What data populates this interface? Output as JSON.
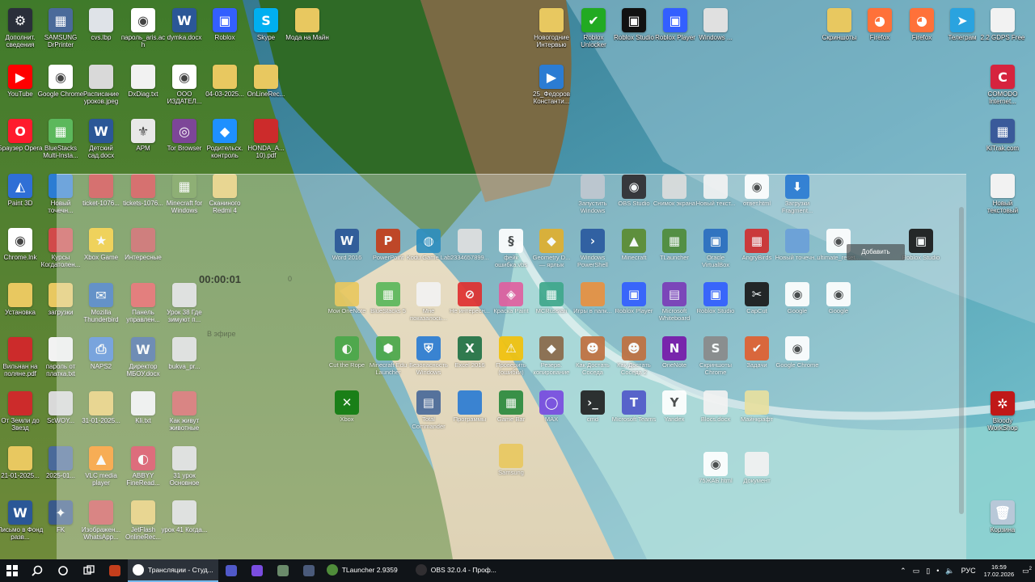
{
  "desktop_left": [
    {
      "label": "Дополнит. сведения",
      "color": "#2a2f3a",
      "glyph": "⚙"
    },
    {
      "label": "SAMSUNG DrPrinter",
      "color": "#4a6a9a",
      "glyph": "▦"
    },
    {
      "label": "cvs.lbp",
      "color": "#dfe3e8",
      "glyph": ""
    },
    {
      "label": "пароль_aris.ach",
      "color": "#ffffff",
      "glyph": "◉"
    },
    {
      "label": "dymka.docx",
      "color": "#2b5797",
      "glyph": "W"
    },
    {
      "label": "Roblox",
      "color": "#335fff",
      "glyph": "▣"
    },
    {
      "label": "Skype",
      "color": "#00aff0",
      "glyph": "S"
    },
    {
      "label": "Мода на Майн",
      "color": "#e8c860",
      "glyph": ""
    },
    {
      "label": "YouTube",
      "color": "#ff0000",
      "glyph": "▶"
    },
    {
      "label": "Google Chrome",
      "color": "#ffffff",
      "glyph": "◉"
    },
    {
      "label": "Расписание уроков.jpeg",
      "color": "#d9d9d9",
      "glyph": ""
    },
    {
      "label": "DxDiag.txt",
      "color": "#f2f2f2",
      "glyph": ""
    },
    {
      "label": "ООО ИЗДАТЕЛ...",
      "color": "#ffffff",
      "glyph": "◉"
    },
    {
      "label": "04-03-2025...",
      "color": "#e8c860",
      "glyph": ""
    },
    {
      "label": "OnLineRec...",
      "color": "#e8c860",
      "glyph": ""
    },
    {
      "label": "Браузер Opera",
      "color": "#ff1b2d",
      "glyph": "O"
    },
    {
      "label": "BlueStacks Multi-Insta...",
      "color": "#5cb85c",
      "glyph": "▦"
    },
    {
      "label": "Детский сад.docx",
      "color": "#2b5797",
      "glyph": "W"
    },
    {
      "label": "АРМ",
      "color": "#e8e8e8",
      "glyph": "⚜"
    },
    {
      "label": "Tor Browser",
      "color": "#7d4698",
      "glyph": "◎"
    },
    {
      "label": "Родительск. контроль",
      "color": "#1e90ff",
      "glyph": "◆"
    },
    {
      "label": "HONDA_A... 10).pdf",
      "color": "#cc2b2b",
      "glyph": ""
    },
    {
      "label": "Paint 3D",
      "color": "#2f6fd6",
      "glyph": "◭"
    },
    {
      "label": "Новый точечн...",
      "color": "#2b7cd3",
      "glyph": ""
    },
    {
      "label": "ticket-1076...",
      "color": "#cc2b2b",
      "glyph": ""
    },
    {
      "label": "tickets-1076...",
      "color": "#cc2b2b",
      "glyph": ""
    },
    {
      "label": "Minecraft for Windows",
      "color": "#5b8c32",
      "glyph": "▦"
    },
    {
      "label": "Сканиного Redmi 4",
      "color": "#e8c860",
      "glyph": ""
    },
    {
      "label": "Chrome.lnk",
      "color": "#ffffff",
      "glyph": "◉"
    },
    {
      "label": "Курсы Когдатолен...",
      "color": "#d14a4a",
      "glyph": ""
    },
    {
      "label": "Xbox Game",
      "color": "#f2c20c",
      "glyph": "★"
    },
    {
      "label": "Интересные",
      "color": "#c04040",
      "glyph": ""
    },
    {
      "label": "Установка",
      "color": "#e8c860",
      "glyph": ""
    },
    {
      "label": "загрузки",
      "color": "#e8c860",
      "glyph": ""
    },
    {
      "label": "Mozilla Thunderbird",
      "color": "#1a5fb4",
      "glyph": "✉"
    },
    {
      "label": "Панель управлен...",
      "color": "#e04040",
      "glyph": ""
    },
    {
      "label": "Урок 38 Где зимуют п...",
      "color": "#d9d9d9",
      "glyph": ""
    },
    {
      "label": "Вильнан на поляне.pdf",
      "color": "#cc2b2b",
      "glyph": ""
    },
    {
      "label": "пароль от платка.txt",
      "color": "#f2f2f2",
      "glyph": ""
    },
    {
      "label": "NAPS2",
      "color": "#3a7bd5",
      "glyph": "⎙"
    },
    {
      "label": "Директор МБОУ.docx",
      "color": "#2b5797",
      "glyph": "W"
    },
    {
      "label": "bukva_pr...",
      "color": "#d9d9d9",
      "glyph": ""
    },
    {
      "label": "От Земли до Звезд",
      "color": "#cc2b2b",
      "glyph": ""
    },
    {
      "label": "ScWOY...",
      "color": "#d9d9d9",
      "glyph": ""
    },
    {
      "label": "31-01-2025...",
      "color": "#e8c860",
      "glyph": ""
    },
    {
      "label": "Kli.txt",
      "color": "#f2f2f2",
      "glyph": ""
    },
    {
      "label": "Как живут животные",
      "color": "#d14a4a",
      "glyph": ""
    },
    {
      "label": "21-01-2025...",
      "color": "#e8c860",
      "glyph": ""
    },
    {
      "label": "2025-01...",
      "color": "#4a6a9a",
      "glyph": ""
    },
    {
      "label": "VLC media player",
      "color": "#ff8800",
      "glyph": "▲"
    },
    {
      "label": "ABBYY FineRead...",
      "color": "#d6243e",
      "glyph": "◐"
    },
    {
      "label": "31 урок Основное",
      "color": "#d9d9d9",
      "glyph": ""
    },
    {
      "label": "Письмо в Фонд разв...",
      "color": "#2b5797",
      "glyph": "W"
    },
    {
      "label": "FK",
      "color": "#3a5a8a",
      "glyph": "✦"
    },
    {
      "label": "Изображен... WhatsApp...",
      "color": "#d14a4a",
      "glyph": ""
    },
    {
      "label": "JetFlash OnlineRec...",
      "color": "#e8c860",
      "glyph": ""
    },
    {
      "label": "урок 41 Когда...",
      "color": "#d9d9d9",
      "glyph": ""
    },
    {
      "label": "Recovery Toolbox",
      "color": "#e04040",
      "glyph": "✚"
    },
    {
      "label": "mygames",
      "color": "#e8e0a0",
      "glyph": ""
    }
  ],
  "desktop_top_right": [
    {
      "label": "Новогодние Интервью",
      "color": "#e8c860",
      "glyph": ""
    },
    {
      "label": "Roblox Unlocker",
      "color": "#22aa22",
      "glyph": "✔"
    },
    {
      "label": "Roblox Studio",
      "color": "#111111",
      "glyph": "▣"
    },
    {
      "label": "Roblox Player",
      "color": "#335fff",
      "glyph": "▣"
    },
    {
      "label": "Windows ...",
      "color": "#e0e0e0",
      "glyph": ""
    },
    {
      "label": "Скриншоты",
      "color": "#e8c860",
      "glyph": ""
    },
    {
      "label": "Firefox",
      "color": "#ff7139",
      "glyph": "◕"
    },
    {
      "label": "Firefox",
      "color": "#ff7139",
      "glyph": "◕"
    },
    {
      "label": "Телеграм",
      "color": "#2aa3df",
      "glyph": "➤"
    },
    {
      "label": "2.2 GDPS Free",
      "color": "#f2f2f2",
      "glyph": ""
    },
    {
      "label": "25_Федоров Константи...",
      "color": "#2b7cd3",
      "glyph": "▶"
    },
    {
      "label": "COMODO Internet...",
      "color": "#d6243e",
      "glyph": "C"
    },
    {
      "label": "KiTrak.com",
      "color": "#3a5a9a",
      "glyph": "▦"
    },
    {
      "label": "Новый текстовый",
      "color": "#f2f2f2",
      "glyph": ""
    },
    {
      "label": "Bloody WorkShop",
      "color": "#c01818",
      "glyph": "✲"
    },
    {
      "label": "Корзина",
      "color": "#b8c8d8",
      "glyph": "🗑"
    }
  ],
  "overlay": {
    "timer": "00:00:01",
    "ghost_a": "0",
    "ghost_b": "В эфире",
    "tooltip": "Добавить",
    "icons": [
      {
        "label": "Запустить Windows Defend...",
        "color": "#c0c8d0",
        "glyph": ""
      },
      {
        "label": "OBS Studio",
        "color": "#302e31",
        "glyph": "◉"
      },
      {
        "label": "Снимок экрана",
        "color": "#dcdcdc",
        "glyph": ""
      },
      {
        "label": "Новый текст...",
        "color": "#f2f2f2",
        "glyph": ""
      },
      {
        "label": "ответ.html",
        "color": "#ffffff",
        "glyph": "◉"
      },
      {
        "label": "Загрузки Fragment...",
        "color": "#2b7cd3",
        "glyph": "⬇"
      },
      {
        "label": "Word 2016",
        "color": "#2b5797",
        "glyph": "W"
      },
      {
        "label": "PowerPoint",
        "color": "#c43e1c",
        "glyph": "P"
      },
      {
        "label": "Kodu Game Lab",
        "color": "#2f8fbf",
        "glyph": "◍"
      },
      {
        "label": "2334657899...",
        "color": "#e0e0e0",
        "glyph": ""
      },
      {
        "label": "фейк ошибка.vbs",
        "color": "#ffffff",
        "glyph": "§"
      },
      {
        "label": "Geometry D... — ярлык",
        "color": "#e0b030",
        "glyph": "◆"
      },
      {
        "label": "Windows PowerShell",
        "color": "#2a5aa0",
        "glyph": "›"
      },
      {
        "label": "Minecraft",
        "color": "#5b8c32",
        "glyph": "▲"
      },
      {
        "label": "TLauncher",
        "color": "#4f8c3a",
        "glyph": "▦"
      },
      {
        "label": "Oracle VirtualBox",
        "color": "#2a6ec0",
        "glyph": "▣"
      },
      {
        "label": "AngryBirds",
        "color": "#d03030",
        "glyph": "▦"
      },
      {
        "label": "Новый точечн...",
        "color": "#6aa0d8",
        "glyph": ""
      },
      {
        "label": "ultimate_reset...",
        "color": "#ffffff",
        "glyph": "◉"
      },
      {
        "label": "Roblox Studio",
        "color": "#1a1a1a",
        "glyph": "▣"
      },
      {
        "label": "Мои OneNote",
        "color": "#e8c860",
        "glyph": ""
      },
      {
        "label": "BlueStacks 5",
        "color": "#5cb85c",
        "glyph": "▦"
      },
      {
        "label": "Мне показалось...",
        "color": "#f2f2f2",
        "glyph": ""
      },
      {
        "label": "Не интересн...",
        "color": "#e03030",
        "glyph": "⊘"
      },
      {
        "label": "Краска Paint",
        "color": "#e060a0",
        "glyph": "◈"
      },
      {
        "label": "MCRussian",
        "color": "#3fa88c",
        "glyph": "▦"
      },
      {
        "label": "Игры в папк...",
        "color": "#e89040",
        "glyph": ""
      },
      {
        "label": "Roblox Player",
        "color": "#335fff",
        "glyph": "▣"
      },
      {
        "label": "Microsoft Whiteboard",
        "color": "#7a3db8",
        "glyph": "▤"
      },
      {
        "label": "Roblox Studio",
        "color": "#335fff",
        "glyph": "▣"
      },
      {
        "label": "CapCut",
        "color": "#1a1a1a",
        "glyph": "✂"
      },
      {
        "label": "Google",
        "color": "#ffffff",
        "glyph": "◉"
      },
      {
        "label": "Google",
        "color": "#ffffff",
        "glyph": "◉"
      },
      {
        "label": "Cut the Rope",
        "color": "#4aa84a",
        "glyph": "◐"
      },
      {
        "label": "Minecraft Edu Launcher",
        "color": "#4aa84a",
        "glyph": "⬢"
      },
      {
        "label": "Безопасность Windows",
        "color": "#2b7cd3",
        "glyph": "⛨"
      },
      {
        "label": "Excel 2016",
        "color": "#217346",
        "glyph": "X"
      },
      {
        "label": "Проверить (ошибки)",
        "color": "#f2c20c",
        "glyph": "⚠"
      },
      {
        "label": "Резерв. копирование",
        "color": "#8a6a4a",
        "glyph": "◆"
      },
      {
        "label": "Как Достать Соседа",
        "color": "#c07040",
        "glyph": "☻"
      },
      {
        "label": "Как Достать Соседа 2",
        "color": "#c07040",
        "glyph": "☻"
      },
      {
        "label": "OneNote",
        "color": "#7719aa",
        "glyph": "N"
      },
      {
        "label": "Скриншоты Chrome",
        "color": "#8a8a8a",
        "glyph": "S"
      },
      {
        "label": "Задачи",
        "color": "#e06030",
        "glyph": "✔"
      },
      {
        "label": "Google Chrome",
        "color": "#ffffff",
        "glyph": "◉"
      },
      {
        "label": "Xbox",
        "color": "#107c10",
        "glyph": "✕"
      },
      {
        "label": "Total Commander",
        "color": "#4a6a9a",
        "glyph": "▤"
      },
      {
        "label": "Программы",
        "color": "#2b7cd3",
        "glyph": ""
      },
      {
        "label": "Game Bar",
        "color": "#2b8a3e",
        "glyph": "▦"
      },
      {
        "label": "MAX",
        "color": "#7a4de0",
        "glyph": "◯"
      },
      {
        "label": "cmd",
        "color": "#222222",
        "glyph": "›_"
      },
      {
        "label": "Microsoft Teams",
        "color": "#5059c9",
        "glyph": "T"
      },
      {
        "label": "Yandex",
        "color": "#ffffff",
        "glyph": "Y"
      },
      {
        "label": "Blocs.docx",
        "color": "#f2f2f2",
        "glyph": ""
      },
      {
        "label": "Майнкрафт",
        "color": "#e8e0a0",
        "glyph": ""
      },
      {
        "label": "Samsung",
        "color": "#e8c860",
        "glyph": ""
      },
      {
        "label": "75ЖАБ.html",
        "color": "#ffffff",
        "glyph": "◉"
      },
      {
        "label": "Документ",
        "color": "#f2f2f2",
        "glyph": ""
      }
    ]
  },
  "taskbar": {
    "apps": [
      {
        "label": "Трансляции - Студ...",
        "color": "#ffffff",
        "active": true
      },
      {
        "label": "TLauncher 2.9359",
        "color": "#4f8c3a",
        "active": false
      },
      {
        "label": "OBS 32.0.4 - Проф...",
        "color": "#302e31",
        "active": false
      }
    ],
    "pins": [
      {
        "name": "powerpoint-icon",
        "color": "#c43e1c"
      },
      {
        "name": "teams-icon",
        "color": "#5059c9"
      },
      {
        "name": "max-icon",
        "color": "#7a4de0"
      },
      {
        "name": "pinned-app-icon",
        "color": "#6a8a6a"
      },
      {
        "name": "camera-icon",
        "color": "#4a5a7a"
      }
    ],
    "language": "РУС",
    "time": "16:59",
    "date": "17.02.2026",
    "notif": "2"
  }
}
